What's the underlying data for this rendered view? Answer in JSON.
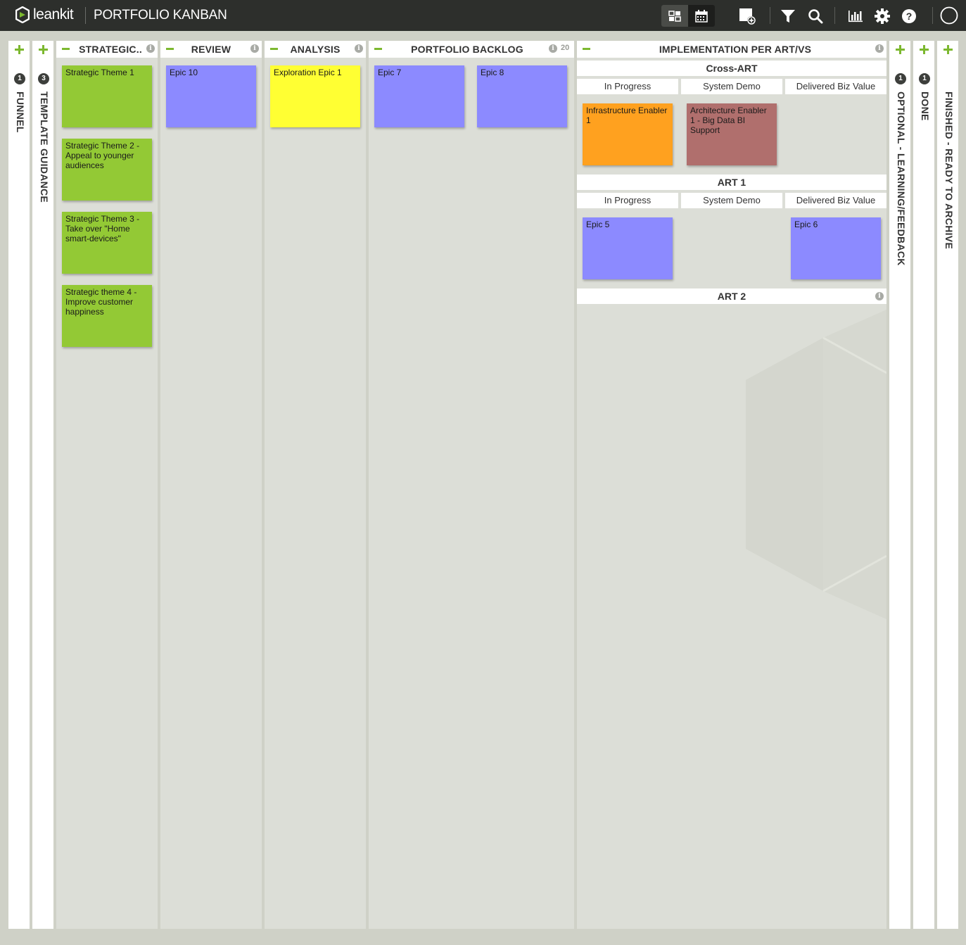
{
  "header": {
    "brand": "leankit",
    "board_title": "PORTFOLIO KANBAN",
    "icons": [
      "board-view-icon",
      "calendar-view-icon",
      "add-card-icon",
      "filter-icon",
      "search-icon",
      "reports-icon",
      "settings-icon",
      "help-icon",
      "user-avatar-icon"
    ]
  },
  "columns": {
    "funnel": {
      "title": "FUNNEL",
      "count": "1"
    },
    "template_guidance": {
      "title": "TEMPLATE GUIDANCE",
      "count": "3"
    },
    "strategic": {
      "title": "STRATEGIC..",
      "cards": [
        {
          "title": "Strategic Theme 1",
          "color": "#93c935"
        },
        {
          "title": "Strategic Theme 2 - Appeal to younger audiences",
          "color": "#93c935"
        },
        {
          "title": "Strategic Theme 3 - Take over \"Home smart-devices\"",
          "color": "#93c935"
        },
        {
          "title": "Strategic theme 4 - Improve customer happiness",
          "color": "#93c935"
        }
      ]
    },
    "review": {
      "title": "REVIEW",
      "cards": [
        {
          "title": "Epic 10",
          "color": "#8c8aff"
        }
      ]
    },
    "analysis": {
      "title": "ANALYSIS",
      "cards": [
        {
          "title": "Exploration Epic 1",
          "color": "#ffff33"
        }
      ]
    },
    "portfolio_backlog": {
      "title": "PORTFOLIO BACKLOG",
      "wip_limit": "20",
      "cards": [
        {
          "title": "Epic 7",
          "color": "#8c8aff"
        },
        {
          "title": "Epic 8",
          "color": "#8c8aff"
        }
      ]
    },
    "implementation": {
      "title": "IMPLEMENTATION PER ART/VS",
      "lanes": [
        {
          "title": "Cross-ART",
          "sub_columns": [
            "In Progress",
            "System Demo",
            "Delivered Biz Value"
          ],
          "cards": [
            {
              "title": "Infrastructure Enabler 1",
              "color": "#ffa11f"
            },
            {
              "title": "Architecture Enabler 1 - Big Data BI Support",
              "color": "#b06f6d"
            }
          ]
        },
        {
          "title": "ART 1",
          "sub_columns": [
            "In Progress",
            "System Demo",
            "Delivered Biz Value"
          ],
          "cards": [
            {
              "title": "Epic 5",
              "color": "#8c8aff"
            },
            {
              "title": "Epic 6",
              "color": "#8c8aff"
            }
          ]
        },
        {
          "title": "ART 2"
        }
      ]
    },
    "optional_learning": {
      "title": "OPTIONAL - LEARNING/FEEDBACK",
      "count": "1"
    },
    "done": {
      "title": "DONE",
      "count": "1"
    },
    "finished": {
      "title": "FINISHED - READY TO ARCHIVE"
    }
  },
  "colors": {
    "topbar": "#2d2f2c",
    "accent_green": "#7cb82f",
    "board_bg": "#cfd1c7",
    "lane_bg": "#dcded7"
  }
}
